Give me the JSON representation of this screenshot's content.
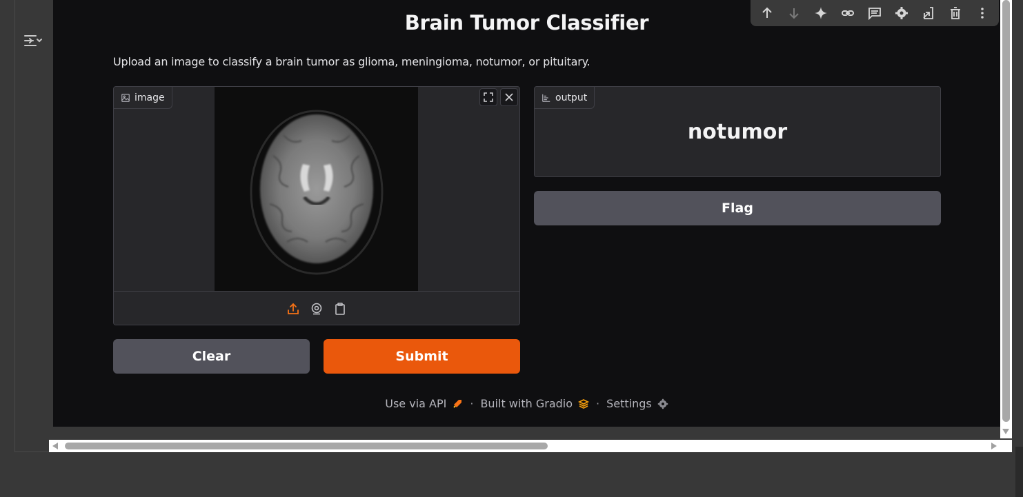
{
  "app": {
    "title": "Brain Tumor Classifier",
    "description": "Upload an image to classify a brain tumor as glioma, meningioma, notumor, or pituitary."
  },
  "image_input": {
    "label": "image",
    "label_icon": "image-icon",
    "controls": [
      "fullscreen-icon",
      "close-icon"
    ],
    "sources": [
      {
        "icon": "upload-icon",
        "active": true
      },
      {
        "icon": "webcam-icon",
        "active": false
      },
      {
        "icon": "clipboard-icon",
        "active": false
      }
    ]
  },
  "output": {
    "label": "output",
    "label_icon": "label-chart-icon",
    "value": "notumor"
  },
  "buttons": {
    "flag": "Flag",
    "clear": "Clear",
    "submit": "Submit"
  },
  "footer": {
    "api": "Use via API",
    "separator": "·",
    "built_with": "Built with Gradio",
    "settings": "Settings"
  },
  "cell_toolbar": {
    "icons": [
      "arrow-up-icon",
      "arrow-down-icon",
      "sparkle-icon",
      "link-icon",
      "comment-icon",
      "gear-icon",
      "edit-cell-icon",
      "trash-icon",
      "more-vertical-icon"
    ]
  },
  "colors": {
    "accent": "#ea580c",
    "secondary_button": "#52525b",
    "panel": "#27272a",
    "background": "#0f0f11"
  }
}
